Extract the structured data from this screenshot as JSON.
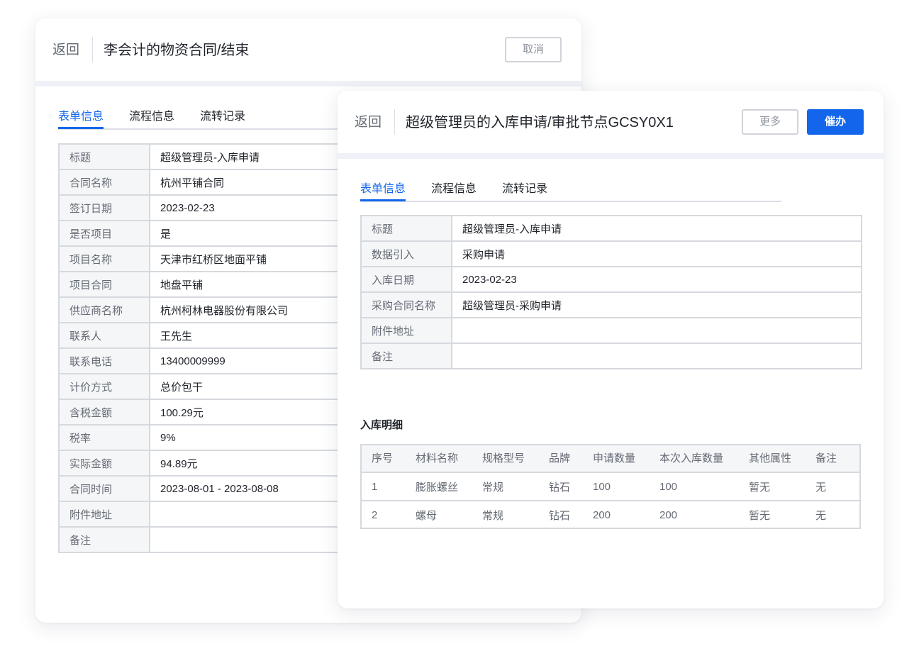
{
  "back_card": {
    "back_label": "返回",
    "title": "李会计的物资合同/结束",
    "cancel_label": "取消",
    "tabs": [
      "表单信息",
      "流程信息",
      "流转记录"
    ],
    "fields": [
      {
        "label": "标题",
        "value": "超级管理员-入库申请"
      },
      {
        "label": "合同名称",
        "value": "杭州平铺合同"
      },
      {
        "label": "签订日期",
        "value": "2023-02-23"
      },
      {
        "label": "是否项目",
        "value": "是"
      },
      {
        "label": "项目名称",
        "value": "天津市红桥区地面平铺"
      },
      {
        "label": "项目合同",
        "value": "地盘平铺"
      },
      {
        "label": "供应商名称",
        "value": "杭州柯林电器股份有限公司"
      },
      {
        "label": "联系人",
        "value": "王先生"
      },
      {
        "label": "联系电话",
        "value": "13400009999"
      },
      {
        "label": "计价方式",
        "value": "总价包干"
      },
      {
        "label": "含税金额",
        "value": "100.29元"
      },
      {
        "label": "税率",
        "value": "9%"
      },
      {
        "label": "实际金额",
        "value": "94.89元"
      },
      {
        "label": "合同时间",
        "value": "2023-08-01 - 2023-08-08"
      },
      {
        "label": "附件地址",
        "value": ""
      },
      {
        "label": "备注",
        "value": ""
      }
    ]
  },
  "front_card": {
    "back_label": "返回",
    "title": "超级管理员的入库申请/审批节点GCSY0X1",
    "more_label": "更多",
    "urge_label": "催办",
    "tabs": [
      "表单信息",
      "流程信息",
      "流转记录"
    ],
    "fields": [
      {
        "label": "标题",
        "value": "超级管理员-入库申请"
      },
      {
        "label": "数据引入",
        "value": "采购申请"
      },
      {
        "label": "入库日期",
        "value": "2023-02-23"
      },
      {
        "label": "采购合同名称",
        "value": "超级管理员-采购申请"
      },
      {
        "label": "附件地址",
        "value": ""
      },
      {
        "label": "备注",
        "value": ""
      }
    ],
    "detail_title": "入库明细",
    "detail_columns": [
      "序号",
      "材料名称",
      "规格型号",
      "品牌",
      "申请数量",
      "本次入库数量",
      "其他属性",
      "备注"
    ],
    "detail_rows": [
      [
        "1",
        "膨胀螺丝",
        "常规",
        "钻石",
        "100",
        "100",
        "暂无",
        "无"
      ],
      [
        "2",
        "螺母",
        "常规",
        "钻石",
        "200",
        "200",
        "暂无",
        "无"
      ]
    ]
  }
}
